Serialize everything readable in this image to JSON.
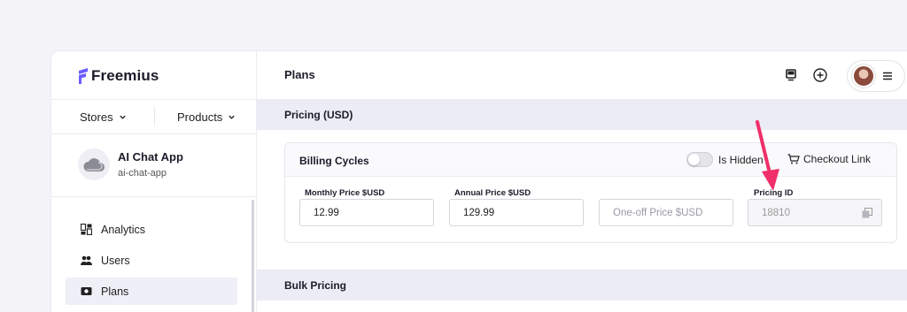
{
  "brand": {
    "name": "Freemius"
  },
  "selectors": {
    "stores_label": "Stores",
    "products_label": "Products"
  },
  "product": {
    "name": "AI Chat App",
    "slug": "ai-chat-app"
  },
  "nav": [
    {
      "label": "Analytics",
      "icon": "analytics-icon"
    },
    {
      "label": "Users",
      "icon": "users-icon"
    },
    {
      "label": "Plans",
      "icon": "plans-icon",
      "active": true
    }
  ],
  "header": {
    "title": "Plans"
  },
  "pricing": {
    "section_title": "Pricing (USD)",
    "card_title": "Billing Cycles",
    "is_hidden_label": "Is Hidden",
    "is_hidden": false,
    "checkout_link_label": "Checkout Link",
    "fields": {
      "monthly": {
        "label": "Monthly Price $USD",
        "value": "12.99"
      },
      "annual": {
        "label": "Annual Price $USD",
        "value": "129.99"
      },
      "oneoff": {
        "placeholder": "One-off Price $USD"
      },
      "pricing_id": {
        "label": "Pricing ID",
        "value": "18810"
      }
    }
  },
  "bulk": {
    "section_title": "Bulk Pricing"
  },
  "colors": {
    "accent": "#6a5cff",
    "annotation_arrow": "#f0306a",
    "active_nav_bg": "#efeff7"
  }
}
